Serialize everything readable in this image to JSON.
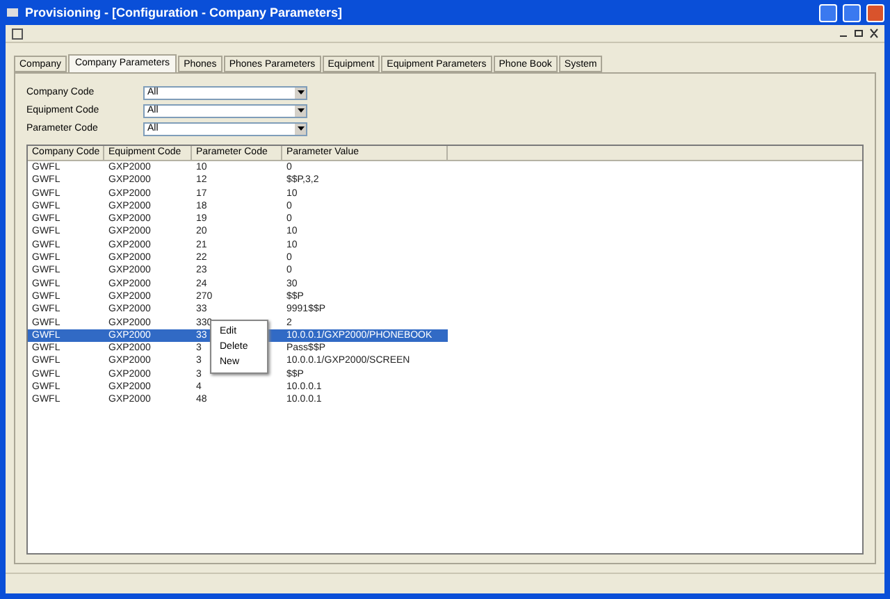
{
  "window": {
    "title": "Provisioning - [Configuration - Company Parameters]"
  },
  "tabs": [
    {
      "label": "Company",
      "selected": false
    },
    {
      "label": "Company Parameters",
      "selected": true
    },
    {
      "label": "Phones",
      "selected": false
    },
    {
      "label": "Phones Parameters",
      "selected": false
    },
    {
      "label": "Equipment",
      "selected": false
    },
    {
      "label": "Equipment Parameters",
      "selected": false
    },
    {
      "label": "Phone Book",
      "selected": false
    },
    {
      "label": "System",
      "selected": false
    }
  ],
  "filters": [
    {
      "label": "Company Code",
      "value": "All"
    },
    {
      "label": "Equipment Code",
      "value": "All"
    },
    {
      "label": "Parameter Code",
      "value": "All"
    }
  ],
  "table": {
    "columns": [
      "Company Code",
      "Equipment Code",
      "Parameter Code",
      "Parameter Value"
    ],
    "rows": [
      {
        "cells": [
          "GWFL",
          "GXP2000",
          "10",
          "0"
        ],
        "selected": false
      },
      {
        "cells": [
          "GWFL",
          "GXP2000",
          "12",
          "$$P,3,2"
        ],
        "selected": false
      },
      {
        "cells": [
          "GWFL",
          "GXP2000",
          "17",
          "10"
        ],
        "selected": false
      },
      {
        "cells": [
          "GWFL",
          "GXP2000",
          "18",
          "0"
        ],
        "selected": false
      },
      {
        "cells": [
          "GWFL",
          "GXP2000",
          "19",
          "0"
        ],
        "selected": false
      },
      {
        "cells": [
          "GWFL",
          "GXP2000",
          "20",
          "10"
        ],
        "selected": false
      },
      {
        "cells": [
          "GWFL",
          "GXP2000",
          "21",
          "10"
        ],
        "selected": false
      },
      {
        "cells": [
          "GWFL",
          "GXP2000",
          "22",
          "0"
        ],
        "selected": false
      },
      {
        "cells": [
          "GWFL",
          "GXP2000",
          "23",
          "0"
        ],
        "selected": false
      },
      {
        "cells": [
          "GWFL",
          "GXP2000",
          "24",
          "30"
        ],
        "selected": false
      },
      {
        "cells": [
          "GWFL",
          "GXP2000",
          "270",
          "$$P"
        ],
        "selected": false
      },
      {
        "cells": [
          "GWFL",
          "GXP2000",
          "33",
          "9991$$P"
        ],
        "selected": false
      },
      {
        "cells": [
          "GWFL",
          "GXP2000",
          "330",
          "2"
        ],
        "selected": false
      },
      {
        "cells": [
          "GWFL",
          "GXP2000",
          "33",
          "10.0.0.1/GXP2000/PHONEBOOK"
        ],
        "selected": true
      },
      {
        "cells": [
          "GWFL",
          "GXP2000",
          "3",
          "Pass$$P"
        ],
        "selected": false
      },
      {
        "cells": [
          "GWFL",
          "GXP2000",
          "3",
          "10.0.0.1/GXP2000/SCREEN"
        ],
        "selected": false
      },
      {
        "cells": [
          "GWFL",
          "GXP2000",
          "3",
          "$$P"
        ],
        "selected": false
      },
      {
        "cells": [
          "GWFL",
          "GXP2000",
          "4",
          "10.0.0.1"
        ],
        "selected": false
      },
      {
        "cells": [
          "GWFL",
          "GXP2000",
          "48",
          "10.0.0.1"
        ],
        "selected": false
      }
    ]
  },
  "context_menu": {
    "items": [
      "Edit",
      "Delete",
      "New"
    ]
  }
}
